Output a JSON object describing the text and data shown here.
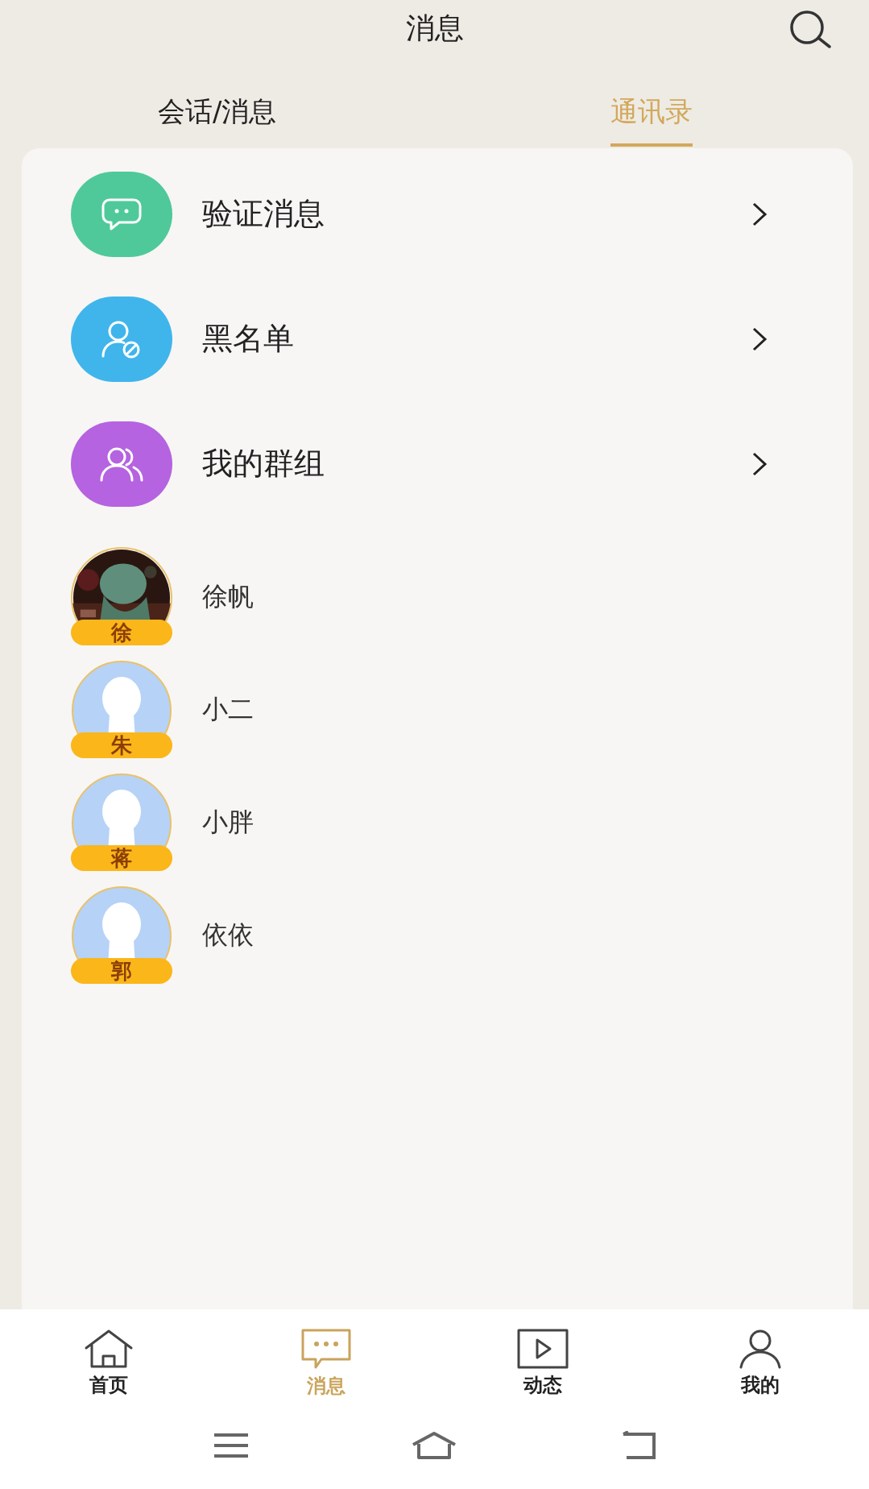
{
  "header": {
    "title": "消息"
  },
  "tabs": [
    {
      "label": "会话/消息",
      "selected": false
    },
    {
      "label": "通讯录",
      "selected": true
    }
  ],
  "menu": [
    {
      "kind": "chat",
      "label": "验证消息",
      "color": "#4fc99a"
    },
    {
      "kind": "blocked",
      "label": "黑名单",
      "color": "#3fb5ec"
    },
    {
      "kind": "group",
      "label": "我的群组",
      "color": "#b563e0"
    }
  ],
  "contacts": [
    {
      "kind": "picture",
      "badge": "徐",
      "name": "徐帆"
    },
    {
      "kind": "default",
      "badge": "朱",
      "name": "小二"
    },
    {
      "kind": "default",
      "badge": "蒋",
      "name": "小胖"
    },
    {
      "kind": "default",
      "badge": "郭",
      "name": "依依"
    }
  ],
  "nav": [
    {
      "kind": "home",
      "label": "首页",
      "selected": false
    },
    {
      "kind": "message",
      "label": "消息",
      "selected": true
    },
    {
      "kind": "video",
      "label": "动态",
      "selected": false
    },
    {
      "kind": "person",
      "label": "我的",
      "selected": false
    }
  ]
}
